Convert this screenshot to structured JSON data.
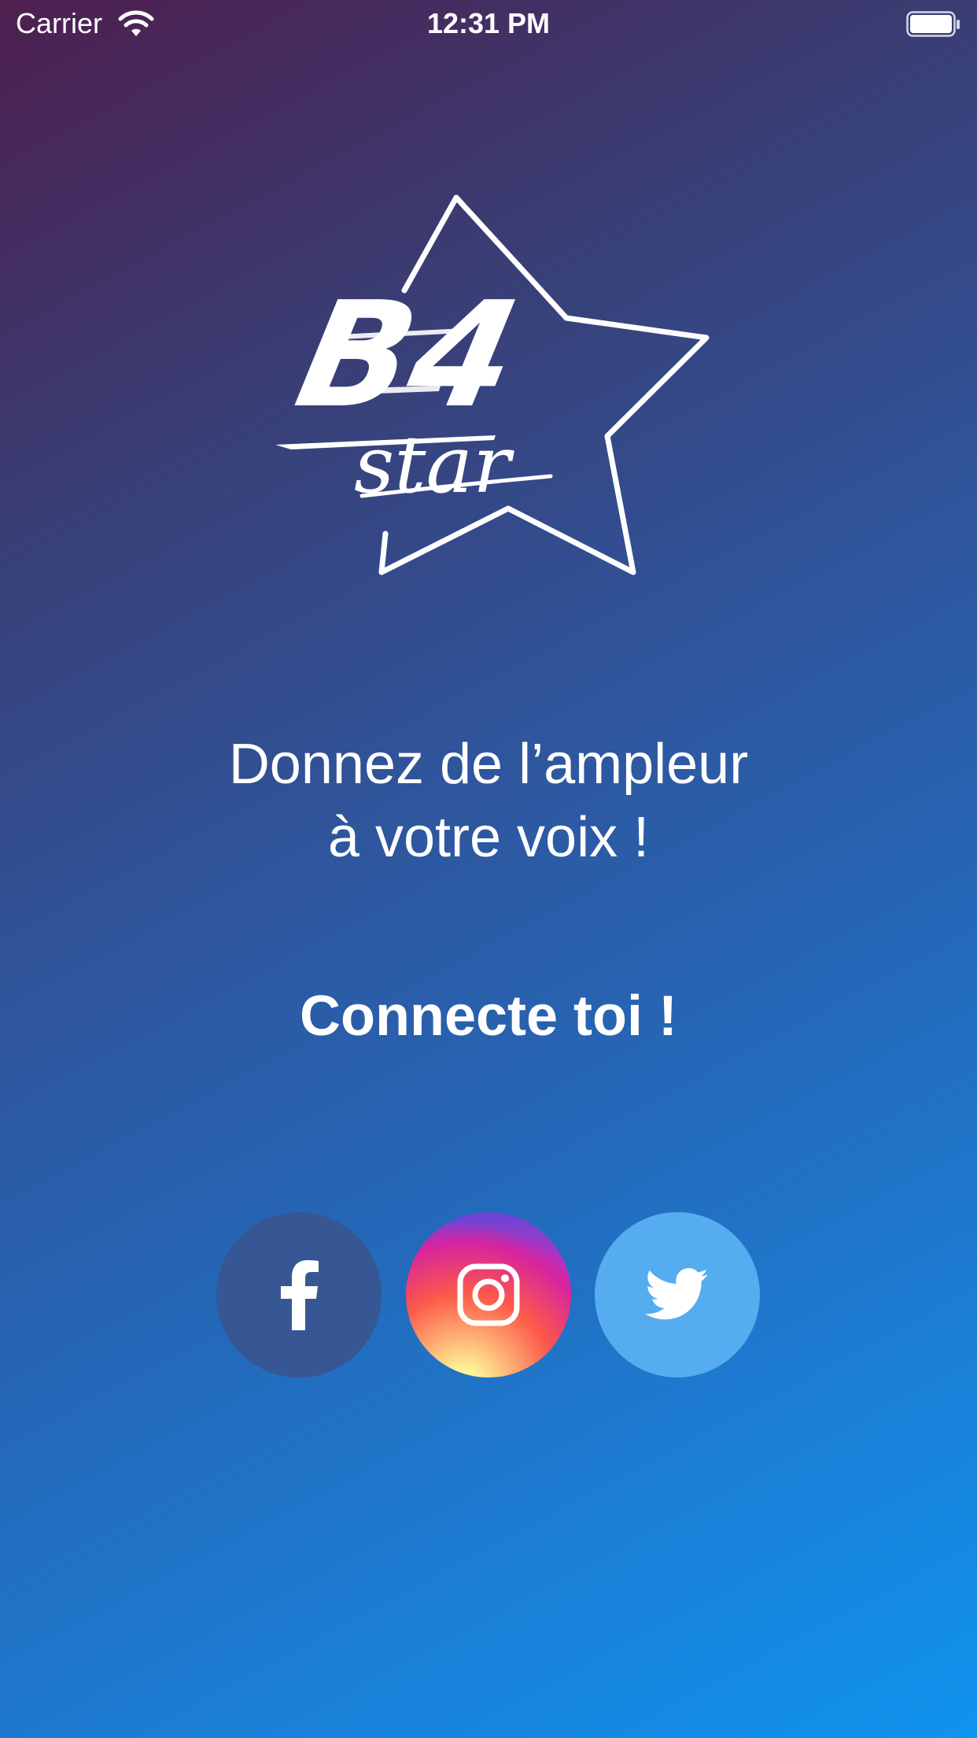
{
  "status_bar": {
    "carrier": "Carrier",
    "time": "12:31 PM",
    "wifi_icon": "wifi-icon",
    "battery_icon": "battery-icon"
  },
  "logo": {
    "text": "B4 star",
    "icon": "star-outline-icon"
  },
  "tagline": {
    "line1": "Donnez de l’ampleur",
    "line2": "à votre voix !"
  },
  "connect": {
    "title": "Connecte toi !"
  },
  "social": [
    {
      "name": "facebook",
      "icon": "facebook-icon",
      "color": "#375694"
    },
    {
      "name": "instagram",
      "icon": "instagram-icon",
      "color": "#d6249f"
    },
    {
      "name": "twitter",
      "icon": "twitter-icon",
      "color": "#55acee"
    }
  ],
  "colors": {
    "background_start": "#4e1f4f",
    "background_end": "#0f93ee",
    "text": "#ffffff"
  }
}
